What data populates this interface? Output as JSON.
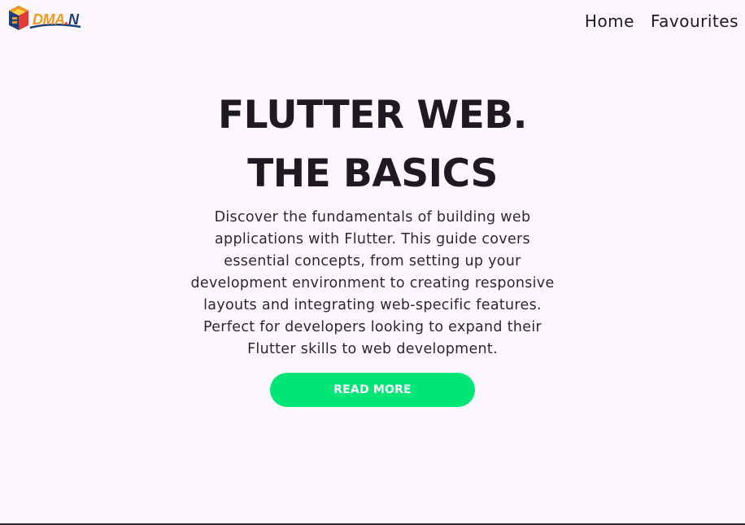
{
  "header": {
    "logo": {
      "icon": "edman-logo-icon",
      "text_part1": "E",
      "text_part2": "DMA",
      "text_dot": ".",
      "text_part3": "N"
    },
    "nav": [
      {
        "label": "Home"
      },
      {
        "label": "Favourites"
      }
    ]
  },
  "hero": {
    "title_line1": "FLUTTER WEB.",
    "title_line2": "THE BASICS",
    "description": "Discover the fundamentals of building web applications with Flutter. This guide covers essential concepts, from setting up your development environment to creating responsive layouts and integrating web-specific features. Perfect for developers looking to expand their Flutter skills to web development.",
    "cta_label": "READ MORE"
  },
  "colors": {
    "background": "#fcf7ff",
    "text": "#1d1b20",
    "cta": "#00e676",
    "cta_text": "#ffffff",
    "logo_orange": "#f29a1f",
    "logo_red": "#e53935",
    "logo_navy": "#1f3f7a"
  }
}
